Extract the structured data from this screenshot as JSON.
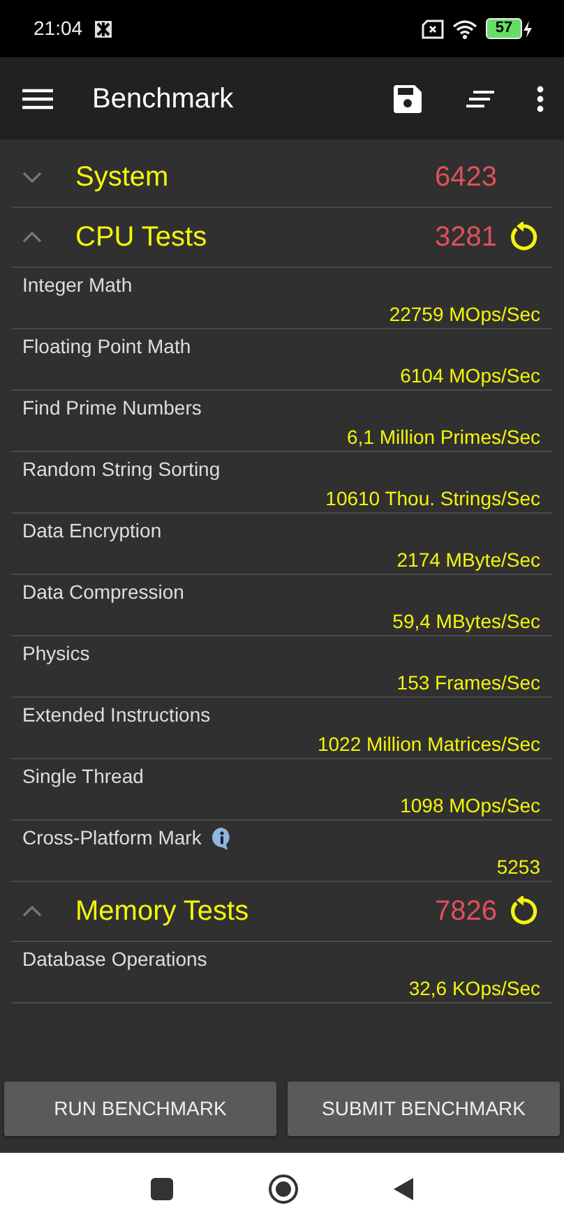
{
  "status_bar": {
    "time": "21:04",
    "battery": "57"
  },
  "toolbar": {
    "title": "Benchmark"
  },
  "sections": [
    {
      "title": "System",
      "score": "6423",
      "expanded": false
    },
    {
      "title": "CPU Tests",
      "score": "3281",
      "expanded": true,
      "items": [
        {
          "label": "Integer Math",
          "value": "22759 MOps/Sec",
          "info": false
        },
        {
          "label": "Floating Point Math",
          "value": "6104 MOps/Sec",
          "info": false
        },
        {
          "label": "Find Prime Numbers",
          "value": "6,1 Million Primes/Sec",
          "info": false
        },
        {
          "label": "Random String Sorting",
          "value": "10610 Thou. Strings/Sec",
          "info": false
        },
        {
          "label": "Data Encryption",
          "value": "2174 MByte/Sec",
          "info": false
        },
        {
          "label": "Data Compression",
          "value": "59,4 MBytes/Sec",
          "info": false
        },
        {
          "label": "Physics",
          "value": "153 Frames/Sec",
          "info": false
        },
        {
          "label": "Extended Instructions",
          "value": "1022 Million Matrices/Sec",
          "info": false
        },
        {
          "label": "Single Thread",
          "value": "1098 MOps/Sec",
          "info": false
        },
        {
          "label": "Cross-Platform Mark",
          "value": "5253",
          "info": true
        }
      ]
    },
    {
      "title": "Memory Tests",
      "score": "7826",
      "expanded": true,
      "items": [
        {
          "label": "Database Operations",
          "value": "32,6 KOps/Sec",
          "info": false
        }
      ]
    }
  ],
  "buttons": [
    "RUN BENCHMARK",
    "SUBMIT BENCHMARK"
  ]
}
